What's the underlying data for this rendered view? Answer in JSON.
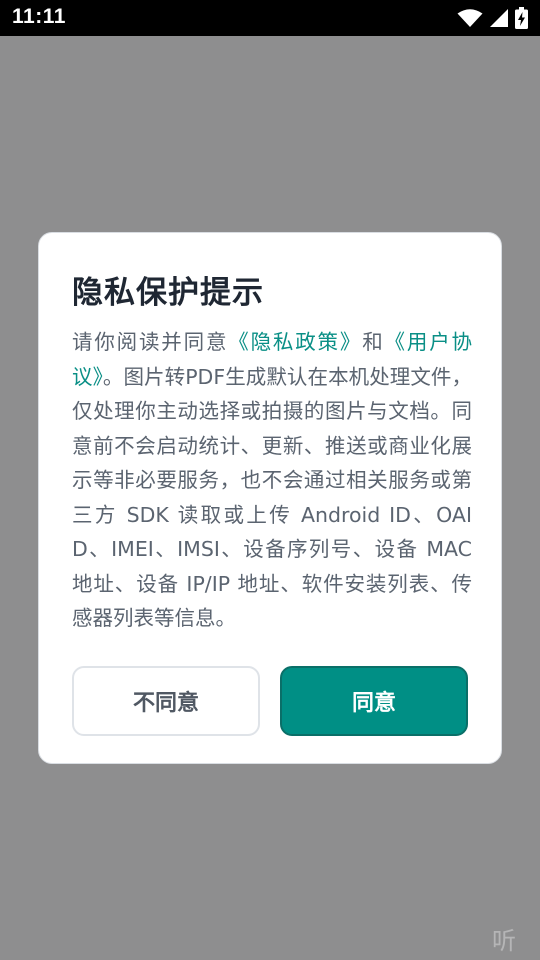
{
  "status_bar": {
    "time": "11:11",
    "icons": [
      "wifi-icon",
      "cellular-signal-icon",
      "battery-charging-icon"
    ]
  },
  "dialog": {
    "title": "隐私保护提示",
    "body": {
      "intro": "请你阅读并同意",
      "privacy_link": "《隐私政策》",
      "and": "和",
      "terms_link": "《用户协议》",
      "rest": "。图片转PDF生成默认在本机处理文件，仅处理你主动选择或拍摄的图片与文档。同意前不会启动统计、更新、推送或商业化展示等非必要服务，也不会通过相关服务或第三方 SDK 读取或上传 Android ID、OAID、IMEI、IMSI、设备序列号、设备 MAC 地址、设备 IP/IP 地址、软件安装列表、传感器列表等信息。"
    },
    "decline_label": "不同意",
    "agree_label": "同意"
  },
  "watermark": "听",
  "colors": {
    "accent": "#008f85",
    "link": "#0a8f86",
    "scrim": "#8e8e8f"
  }
}
